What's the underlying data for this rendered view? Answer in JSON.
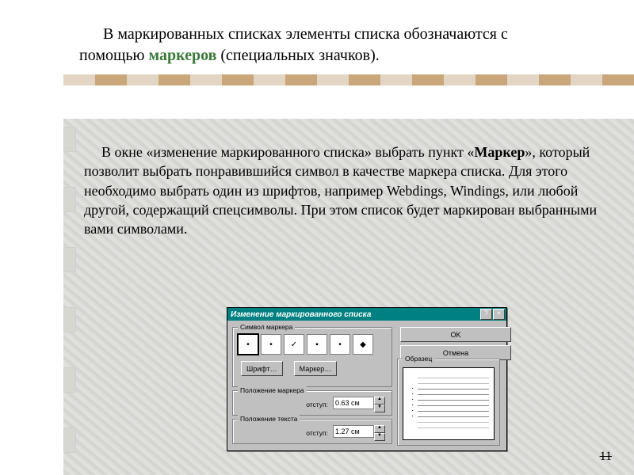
{
  "intro": {
    "part1": "В маркированных списках элементы списка обозначаются с помощью ",
    "markers_word": "маркеров",
    "part2": " (специальных значков)."
  },
  "desc": {
    "part1": "В окне «изменение маркированного списка» выбрать пункт «",
    "bold": "Маркер",
    "part2": "», который позволит выбрать понравившийся символ в качестве маркера списка. Для этого необходимо выбрать один из шрифтов, например Webdings, Windings, или любой другой, содержащий спецсимволы. При этом список будет маркирован выбранными вами символами."
  },
  "window": {
    "title": "Изменение маркированного списка",
    "help": "?",
    "close": "×",
    "symbol_group": "Символ маркера",
    "markers": [
      "•",
      "•",
      "✓",
      "▪",
      "•",
      "◆"
    ],
    "font_btn": "Шрифт…",
    "marker_btn": "Маркер…",
    "pos_marker": {
      "label": "Положение маркера",
      "field_label": "отступ:",
      "value": "0.63 см"
    },
    "pos_text": {
      "label": "Положение текста",
      "field_label": "отступ:",
      "value": "1.27 см"
    },
    "sample_label": "Образец",
    "ok": "OK",
    "cancel": "Отмена"
  },
  "page_number": "11"
}
